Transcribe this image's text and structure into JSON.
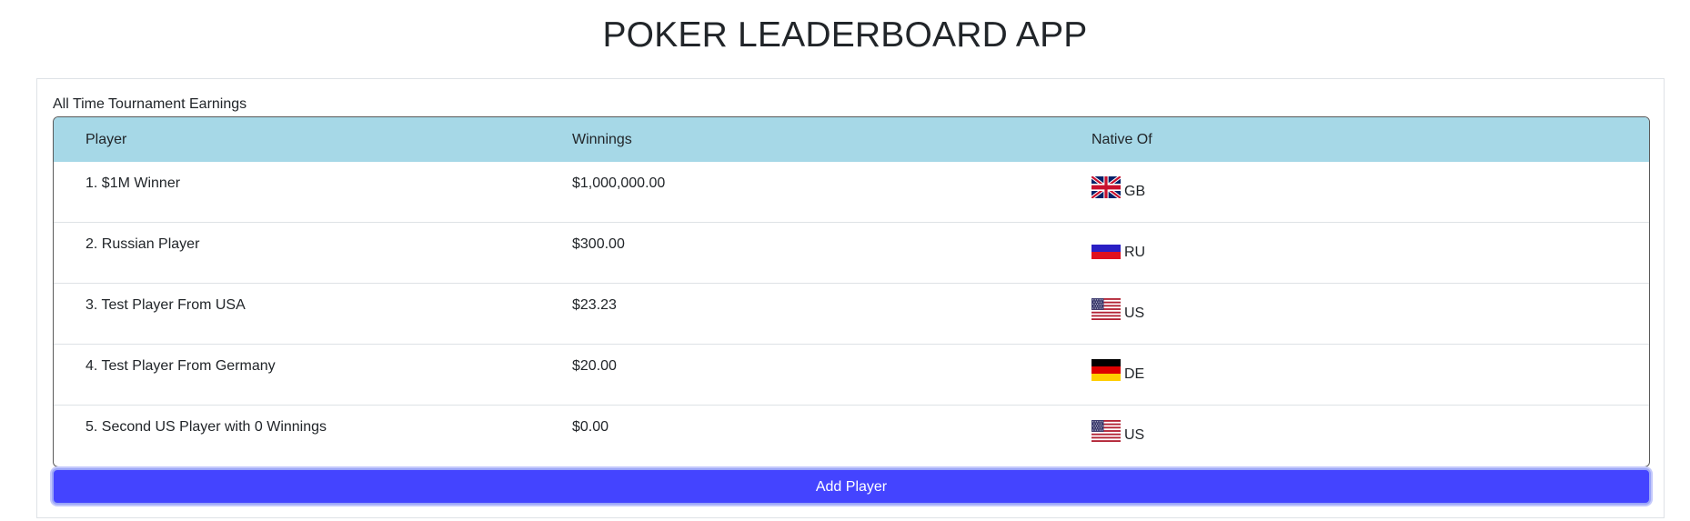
{
  "app": {
    "title": "POKER LEADERBOARD APP"
  },
  "leaderboard": {
    "caption": "All Time Tournament Earnings",
    "columns": {
      "player": "Player",
      "winnings": "Winnings",
      "native": "Native Of"
    },
    "rows": [
      {
        "player": "1. $1M Winner",
        "winnings": "$1,000,000.00",
        "country": "GB",
        "flag_icon": "uk-flag-icon"
      },
      {
        "player": "2. Russian Player",
        "winnings": "$300.00",
        "country": "RU",
        "flag_icon": "russia-flag-icon"
      },
      {
        "player": "3. Test Player From USA",
        "winnings": "$23.23",
        "country": "US",
        "flag_icon": "usa-flag-icon"
      },
      {
        "player": "4. Test Player From Germany",
        "winnings": "$20.00",
        "country": "DE",
        "flag_icon": "germany-flag-icon"
      },
      {
        "player": "5. Second US Player with 0 Winnings",
        "winnings": "$0.00",
        "country": "US",
        "flag_icon": "usa-flag-icon"
      }
    ],
    "header_color": "#a6d8e7"
  },
  "actions": {
    "add_player_label": "Add Player",
    "button_color": "#4444ff"
  }
}
